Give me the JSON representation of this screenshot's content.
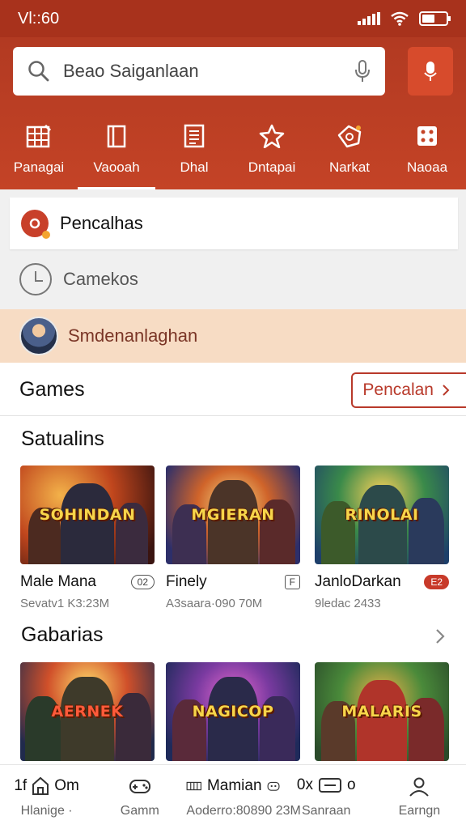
{
  "status": {
    "time": "Vl::60"
  },
  "search": {
    "placeholder": "Beao Saiganlaan"
  },
  "categories": [
    {
      "label": "Panagai",
      "icon": "grid-icon"
    },
    {
      "label": "Vaooah",
      "icon": "book-icon"
    },
    {
      "label": "Dhal",
      "icon": "document-icon"
    },
    {
      "label": "Dntapai",
      "icon": "star-icon"
    },
    {
      "label": "Narkat",
      "icon": "tag-icon"
    },
    {
      "label": "Naoaa",
      "icon": "dice-icon"
    }
  ],
  "suggestions": {
    "first": "Pencalhas",
    "history": "Camekos",
    "promo": "Smdenanlaghan"
  },
  "games_section": {
    "title": "Games",
    "pill_label": "Pencalan"
  },
  "section1": {
    "title": "Satualins",
    "cards": [
      {
        "art_text": "SOHINDAN",
        "name": "Male Mana",
        "badge": "02",
        "meta": "Sevatv1 K3:23M"
      },
      {
        "art_text": "MGIERAN",
        "name": "Finely",
        "badge": "F",
        "meta": "A3saara·090 70M"
      },
      {
        "art_text": "RINOLAI",
        "name": "JanloDarkan",
        "badge": "E2",
        "meta": "9ledac 2433"
      }
    ]
  },
  "section2": {
    "title": "Gabarias",
    "cards": [
      {
        "art_text": "AERNEK"
      },
      {
        "art_text": "NAGICOP"
      },
      {
        "art_text": "MALARIS"
      }
    ]
  },
  "bottom_nav": [
    {
      "top": "Om",
      "prefix": "1f",
      "label": "Hlanige ·"
    },
    {
      "top": "",
      "label": "Gamm"
    },
    {
      "top": "Mamian",
      "label": "Aoderro:80890 23M"
    },
    {
      "top": "0x",
      "suffix": "o",
      "label": "Sanraan"
    },
    {
      "top": "",
      "label": "Earngn"
    }
  ],
  "colors": {
    "brand": "#b23a22",
    "accent": "#c83a2a",
    "promo_bg": "#f7dcc4"
  }
}
